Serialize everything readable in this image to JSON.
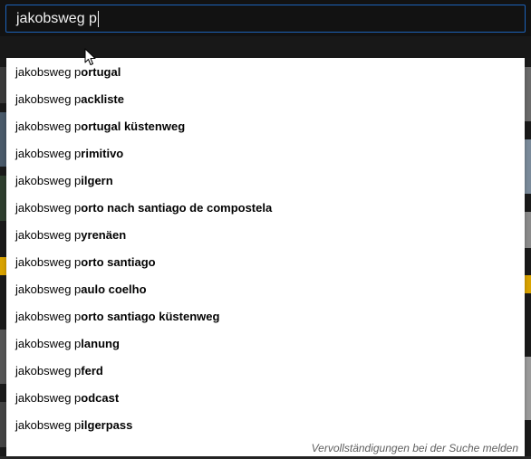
{
  "search": {
    "value": "jakobsweg p"
  },
  "suggestions": [
    {
      "typed": "jakobsweg p",
      "completion": "ortugal"
    },
    {
      "typed": "jakobsweg p",
      "completion": "ackliste"
    },
    {
      "typed": "jakobsweg p",
      "completion": "ortugal küstenweg"
    },
    {
      "typed": "jakobsweg p",
      "completion": "rimitivo"
    },
    {
      "typed": "jakobsweg p",
      "completion": "ilgern"
    },
    {
      "typed": "jakobsweg p",
      "completion": "orto nach santiago de compostela"
    },
    {
      "typed": "jakobsweg p",
      "completion": "yrenäen"
    },
    {
      "typed": "jakobsweg p",
      "completion": "orto santiago"
    },
    {
      "typed": "jakobsweg p",
      "completion": "aulo coelho"
    },
    {
      "typed": "jakobsweg p",
      "completion": "orto santiago küstenweg"
    },
    {
      "typed": "jakobsweg p",
      "completion": "lanung"
    },
    {
      "typed": "jakobsweg p",
      "completion": "ferd"
    },
    {
      "typed": "jakobsweg p",
      "completion": "odcast"
    },
    {
      "typed": "jakobsweg p",
      "completion": "ilgerpass"
    }
  ],
  "report_link": "Vervollständigungen bei der Suche melden",
  "colors": {
    "input_border": "#1c62b9",
    "input_bg": "#121212",
    "dropdown_bg": "#ffffff",
    "suggestion_text": "#030303",
    "report_text": "#606060"
  },
  "icons": {
    "pointer": "mouse-pointer-icon"
  }
}
